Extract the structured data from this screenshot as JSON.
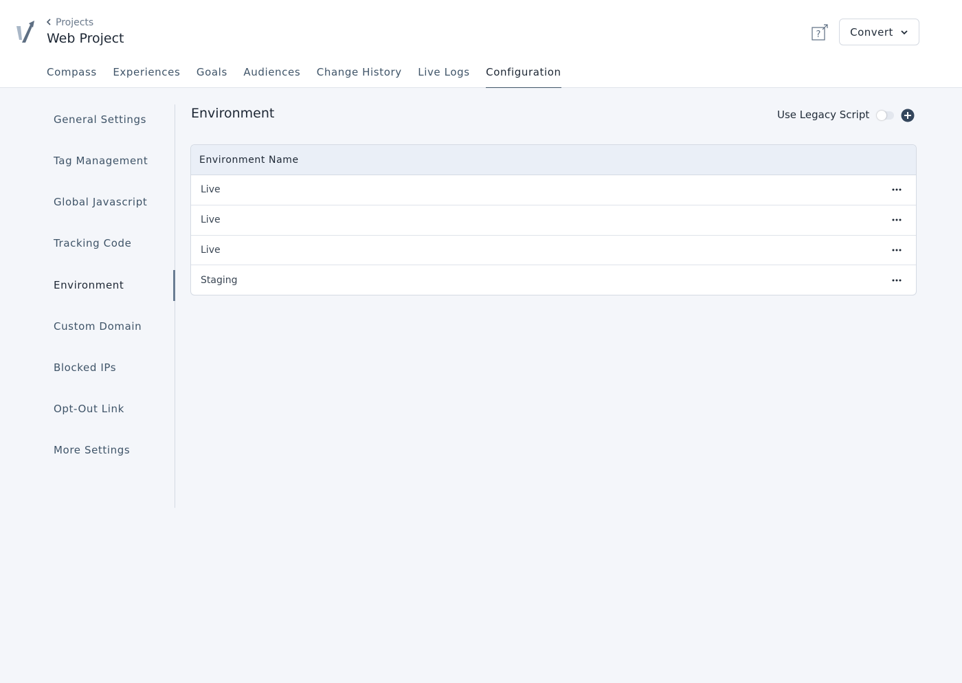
{
  "breadcrumb": {
    "parent": "Projects"
  },
  "page": {
    "title": "Web Project"
  },
  "account": {
    "label": "Convert"
  },
  "tabs": [
    {
      "label": "Compass"
    },
    {
      "label": "Experiences"
    },
    {
      "label": "Goals"
    },
    {
      "label": "Audiences"
    },
    {
      "label": "Change History"
    },
    {
      "label": "Live Logs"
    },
    {
      "label": "Configuration",
      "active": true
    }
  ],
  "sidebar": {
    "items": [
      {
        "label": "General Settings"
      },
      {
        "label": "Tag Management"
      },
      {
        "label": "Global Javascript"
      },
      {
        "label": "Tracking Code"
      },
      {
        "label": "Environment",
        "active": true
      },
      {
        "label": "Custom Domain"
      },
      {
        "label": "Blocked IPs"
      },
      {
        "label": "Opt-Out Link"
      },
      {
        "label": "More Settings"
      }
    ]
  },
  "section": {
    "title": "Environment",
    "legacy_label": "Use Legacy Script",
    "legacy_enabled": false
  },
  "table": {
    "header": "Environment Name",
    "rows": [
      {
        "name": "Live"
      },
      {
        "name": "Live"
      },
      {
        "name": "Live"
      },
      {
        "name": "Staging"
      }
    ]
  },
  "icons": {
    "logo": "convert-logo-icon",
    "back": "chevron-left-icon",
    "help": "help-external-icon",
    "dropdown": "chevron-down-icon",
    "add": "plus-circle-icon",
    "row_menu": "ellipsis-icon"
  },
  "colors": {
    "background": "#f4f6fa",
    "text_primary": "#1c2633",
    "text_secondary": "#3f5468",
    "table_header": "#eaeff7"
  }
}
